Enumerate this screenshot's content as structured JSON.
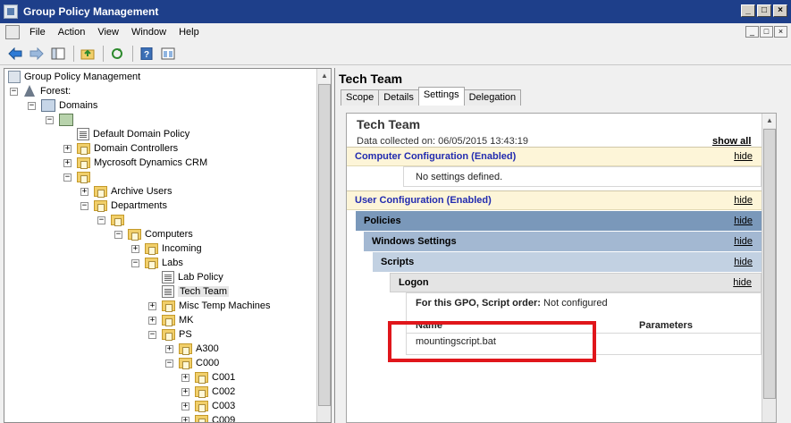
{
  "window": {
    "title": "Group Policy Management",
    "buttons": [
      "_",
      "□",
      "×"
    ]
  },
  "menu": {
    "items": [
      "File",
      "Action",
      "View",
      "Window",
      "Help"
    ]
  },
  "tree": {
    "root": "Group Policy Management",
    "forest": "Forest:",
    "domains": "Domains",
    "items": {
      "default_policy": "Default Domain Policy",
      "domain_controllers": "Domain Controllers",
      "crm": "Mycrosoft Dynamics CRM",
      "archive": "Archive Users",
      "departments": "Departments",
      "computers": "Computers",
      "incoming": "Incoming",
      "labs": "Labs",
      "lab_policy": "Lab Policy",
      "tech_team": "Tech Team",
      "misc": "Misc Temp Machines",
      "mk": "MK",
      "ps": "PS",
      "a300": "A300",
      "c000": "C000",
      "c001": "C001",
      "c002": "C002",
      "c003": "C003",
      "c009": "C009"
    }
  },
  "detail": {
    "title": "Tech Team",
    "tabs": [
      "Scope",
      "Details",
      "Settings",
      "Delegation"
    ],
    "active_tab": "Settings"
  },
  "report": {
    "title": "Tech Team",
    "date": "Data collected on: 06/05/2015 13:43:19",
    "show_all": "show all",
    "hide": "hide",
    "computer_config": "Computer Configuration (Enabled)",
    "no_settings": "No settings defined.",
    "user_config": "User Configuration (Enabled)",
    "policies": "Policies",
    "windows_settings": "Windows Settings",
    "scripts": "Scripts",
    "logon": "Logon",
    "script_order_label": "For this GPO, Script order:",
    "script_order_value": " Not configured",
    "col_name": "Name",
    "col_params": "Parameters",
    "script_file": "mountingscript.bat"
  }
}
